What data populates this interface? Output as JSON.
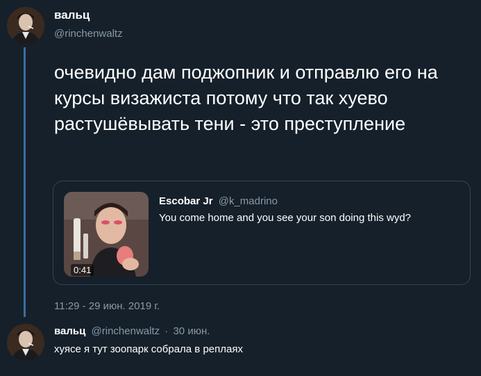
{
  "tweet": {
    "author_name": "вальц",
    "author_handle": "@rinchenwaltz",
    "text": "очевидно дам поджопник и отправлю его на курсы визажиста потому что так хуево растушёвывать тени - это преступление",
    "timestamp": "11:29 - 29 июн. 2019 г."
  },
  "quoted_tweet": {
    "author_name": "Escobar Jr",
    "author_handle": "@k_madrino",
    "text": "You come home and you see your son doing this wyd?",
    "video_duration": "0:41"
  },
  "reply": {
    "author_name": "вальц",
    "author_handle": "@rinchenwaltz",
    "separator": "·",
    "date": "30 июн.",
    "text": "хуясе я тут зоопарк собрала в реплаях"
  },
  "colors": {
    "background": "#15202b",
    "text_primary": "#ffffff",
    "text_secondary": "#8899a6",
    "border": "#38444d",
    "thread_line": "#3b6f9c"
  }
}
